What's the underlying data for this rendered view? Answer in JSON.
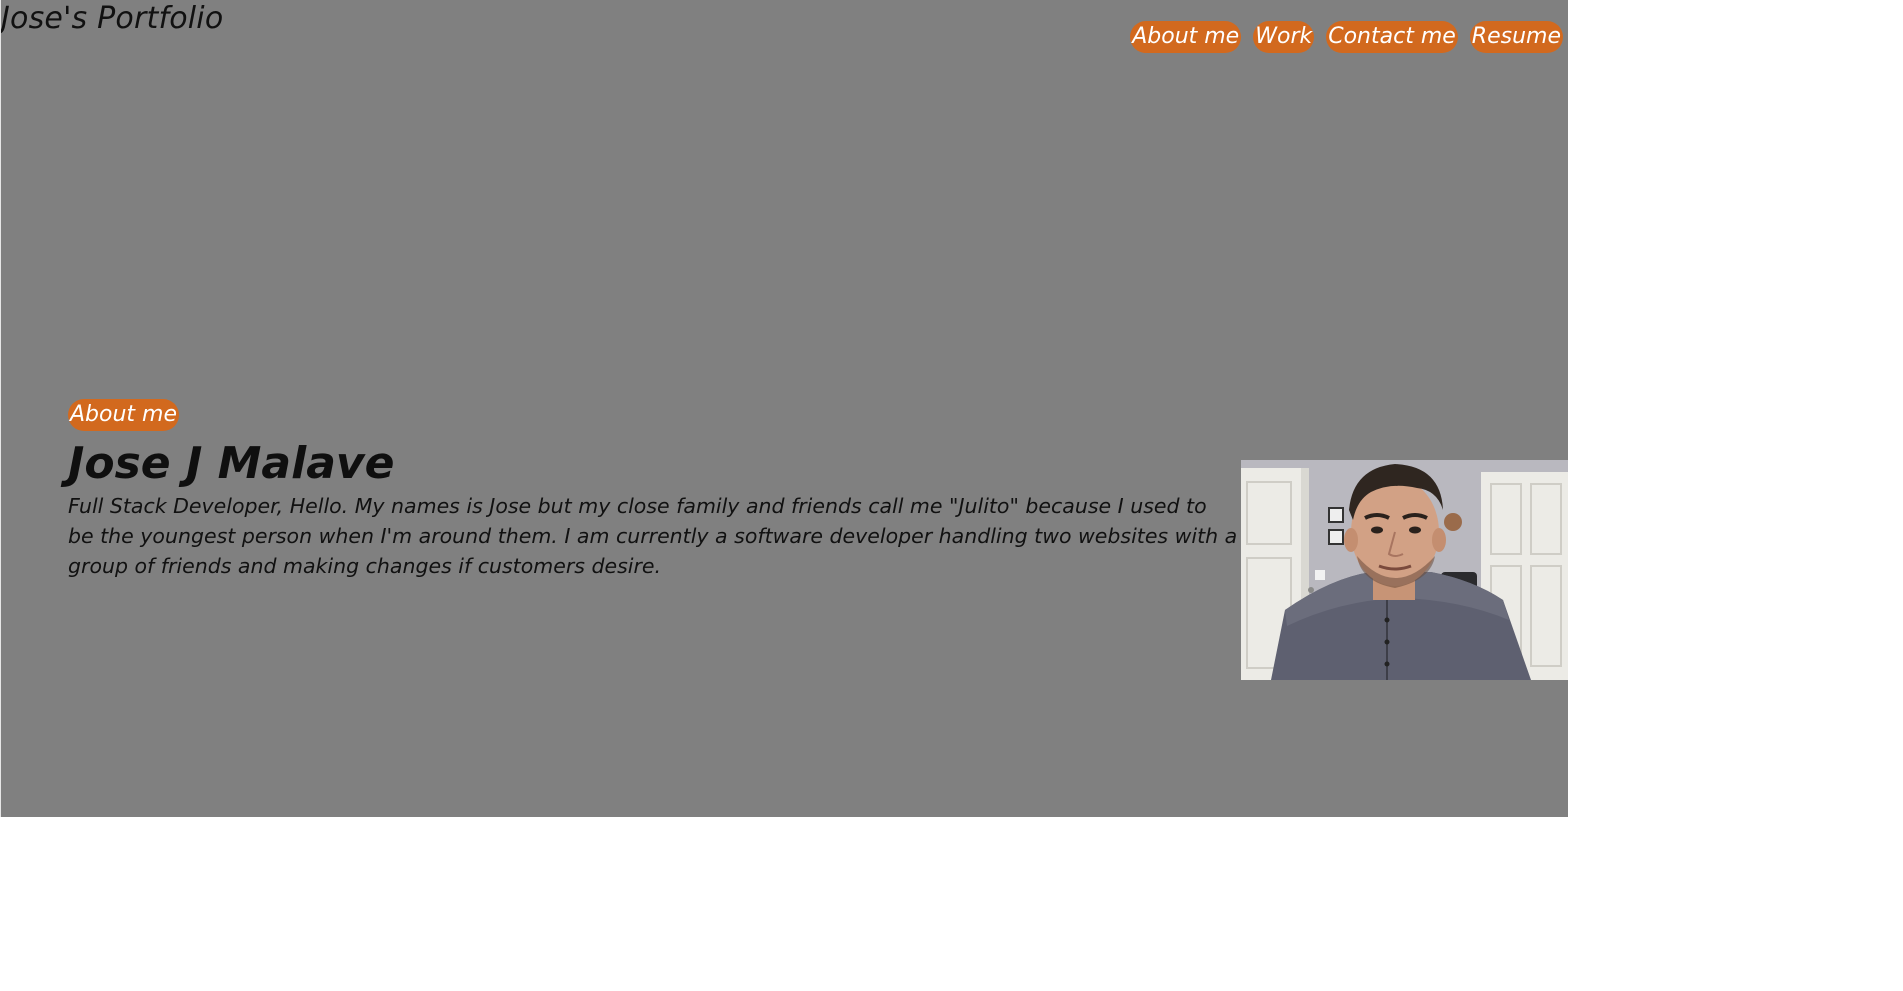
{
  "header": {
    "site_title": "Jose's Portfolio"
  },
  "nav": {
    "items": [
      {
        "label": "About me"
      },
      {
        "label": "Work"
      },
      {
        "label": "Contact me"
      },
      {
        "label": "Resume"
      }
    ]
  },
  "about": {
    "badge": "About me",
    "name": "Jose J Malave",
    "bio": "Full Stack Developer, Hello. My names is Jose but my close family and friends call me \"Julito\" because I used to be the youngest person when I'm around them. I am currently a software developer handling two websites with a group of friends and making changes if customers desire."
  },
  "colors": {
    "page_background": "#808080",
    "accent": "#d2691e",
    "text": "#111111",
    "pill_text": "#ffffff"
  }
}
